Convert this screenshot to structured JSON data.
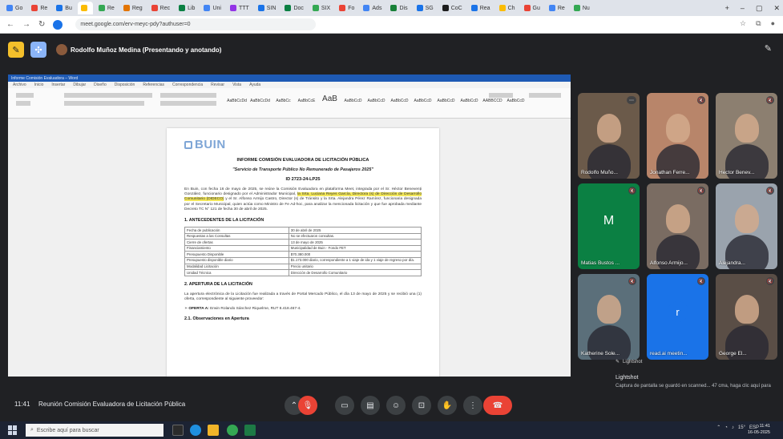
{
  "browser": {
    "tabs": [
      "Go",
      "Re",
      "Bu",
      "",
      "Re",
      "Reg",
      "Rec",
      "Lib",
      "Uni",
      "TTT",
      "SIN",
      "Doc",
      "SIX",
      "Fo",
      "Ads",
      "Dis",
      "SG",
      "CoC",
      "Rea",
      "Ch",
      "Gu",
      "Re",
      "Nu"
    ],
    "url": "meet.google.com/erv-meyc-pdy?authuser=0",
    "new_tab": "+",
    "minimize": "–",
    "maximize": "▢",
    "close": "✕"
  },
  "meet": {
    "presenter_label": "Rodolfo Muñoz Medina (Presentando y anotando)",
    "clock": "11:41",
    "meeting_name": "Reunión Comisión Evaluadora de Licitación Pública"
  },
  "document": {
    "logo": "BUIN",
    "title": "INFORME COMISIÓN EVALUADORA DE LICITACIÓN PÚBLICA",
    "subtitle": "\"Servicio de Transporte Público No Remunerado de Pasajeros 2025\"",
    "id": "ID 2723-24-LP25",
    "intro_a": "En Buin, con fecha 16 de mayo de 2025, se reúne la Comisión Evaluadora en plataforma Meet, integrada por el Sr. Héctor Benevenți González, funcionario designado por el Administrador Municipal,",
    "intro_hl": "la Srta. Luciana Reyes García, Directora (s) de Dirección de Desarrollo Comunitario (DIDECO)",
    "intro_b": "y el Sr. Alfonso Armijo Castro, Director (s) de Tránsito y la Srta. Alejandra Pérez Ramírez, funcionaria designada por el Secretario Municipal, quien actúa como Ministro de Fe Ad-hoc, para analizar la mencionada licitación y que fue aprobada mediante Decreto TC N° 121 de fecha 30 de abril de 2025.",
    "section1": "1.    ANTECEDENTES DE LA LICITACIÓN",
    "table": [
      [
        "Fecha de publicación",
        "30 de abril de 2025"
      ],
      [
        "Respuestas a las Consultas",
        "No se efectuaron consultas."
      ],
      [
        "Cierre de ofertas",
        "13 de mayo de 2025"
      ],
      [
        "Financiamiento",
        "Municipalidad de Buin - Fondo FET"
      ],
      [
        "Presupuesto Disponible",
        "$70.380.000"
      ],
      [
        "Presupuesto disponible diario",
        "$1.173.000 diario, correspondiente a 1 viaje de ida y 1 viaje de regreso por día."
      ],
      [
        "Modalidad Licitación",
        "Precio unitario"
      ],
      [
        "Unidad Técnica",
        "Dirección de Desarrollo Comunitario"
      ]
    ],
    "section2": "2.    APERTURA DE LA LICITACIÓN",
    "apertura": "La apertura electrónica de la Licitación fue realizada a través de Portal Mercado Público, el día 13 de mayo de 2025 y se recibió una (1) oferta, correspondiente al siguiente proveedor:",
    "oferta_label": "OFERTA A:",
    "oferta_value": "Erwin Rolando Sánchez Riquelme, RUT 8.418.467-4.",
    "obs": "2.1.    Observaciones en Apertura"
  },
  "word": {
    "title_text": "Informe Comisión Evaluadora – Word",
    "tabs": [
      "Archivo",
      "Inicio",
      "Insertar",
      "Dibujar",
      "Diseño",
      "Disposición",
      "Referencias",
      "Correspondencia",
      "Revisar",
      "Vista",
      "Ayuda"
    ],
    "styles": [
      "AaBbCcDd",
      "AaBbCcDd",
      "AaBbCc",
      "AaBbCcE",
      "AaB",
      "AaBbCcD",
      "AaBbCcD",
      "AaBbCcD",
      "AaBbCcD",
      "AaBbCcD",
      "AaBbCcD",
      "AABBCCD",
      "AaBbCcD"
    ]
  },
  "participants": [
    {
      "name": "Rodolfo Muño...",
      "type": "video",
      "bg": "#6b5a4a"
    },
    {
      "name": "Jonathan Ferre...",
      "type": "video",
      "bg": "#b8856a"
    },
    {
      "name": "Hector Benev...",
      "type": "video",
      "bg": "#8c7f70"
    },
    {
      "name": "Matias Bustos ...",
      "type": "letter",
      "letter": "M",
      "bg": "#0b8043"
    },
    {
      "name": "Alfonso Armijo...",
      "type": "video",
      "bg": "#7a6c62"
    },
    {
      "name": "Alejandra...",
      "type": "video",
      "bg": "#9aa3ad"
    },
    {
      "name": "Katherine Sole...",
      "type": "video",
      "bg": "#5b6f7a"
    },
    {
      "name": "read.ai meetin...",
      "type": "letter",
      "letter": "r",
      "bg": "#1a73e8"
    },
    {
      "name": "George El...",
      "type": "video",
      "bg": "#5a4e46"
    }
  ],
  "chat": {
    "header": "Lightshot",
    "sender": "Lightshot",
    "message": "Captura de pantalla se guardó en scanned... 47 cma, haga clic aquí para abrir la captura"
  },
  "taskbar": {
    "search_placeholder": "Escribe aquí para buscar",
    "time": "11:41",
    "date": "16-05-2025",
    "temp": "15°",
    "lang": "ESP"
  },
  "colors": {
    "meet_bg": "#202124",
    "hangup": "#ea4335",
    "word_blue": "#1e5ab4",
    "highlight": "#f3e85a"
  }
}
